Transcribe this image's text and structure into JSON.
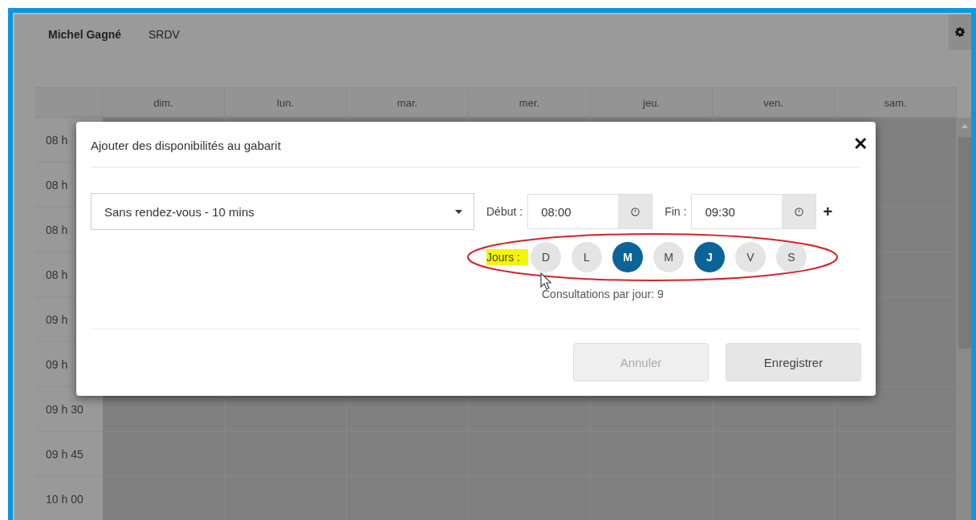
{
  "header": {
    "user": "Michel Gagné",
    "section": "SRDV"
  },
  "calendar": {
    "days": [
      "dim.",
      "lun.",
      "mar.",
      "mer.",
      "jeu.",
      "ven.",
      "sam."
    ],
    "times": [
      "08 h",
      "08 h",
      "08 h",
      "08 h",
      "09 h",
      "09 h",
      "09 h 30",
      "09 h 45",
      "10 h 00"
    ]
  },
  "dialog": {
    "title": "Ajouter des disponibilités au gabarit",
    "close": "✕",
    "type_select": {
      "value": "Sans rendez-vous - 10 mins"
    },
    "start": {
      "label": "Début :",
      "value": "08:00"
    },
    "end": {
      "label": "Fin :",
      "value": "09:30"
    },
    "add": "+",
    "days_label": "Jours :",
    "days": [
      {
        "label": "D",
        "selected": false
      },
      {
        "label": "L",
        "selected": false
      },
      {
        "label": "M",
        "selected": true
      },
      {
        "label": "M",
        "selected": false
      },
      {
        "label": "J",
        "selected": true
      },
      {
        "label": "V",
        "selected": false
      },
      {
        "label": "S",
        "selected": false
      }
    ],
    "consultations": "Consultations par jour: 9",
    "buttons": [
      {
        "label": "Annuler",
        "disabled": true
      },
      {
        "label": "Enregistrer",
        "disabled": false
      }
    ]
  }
}
